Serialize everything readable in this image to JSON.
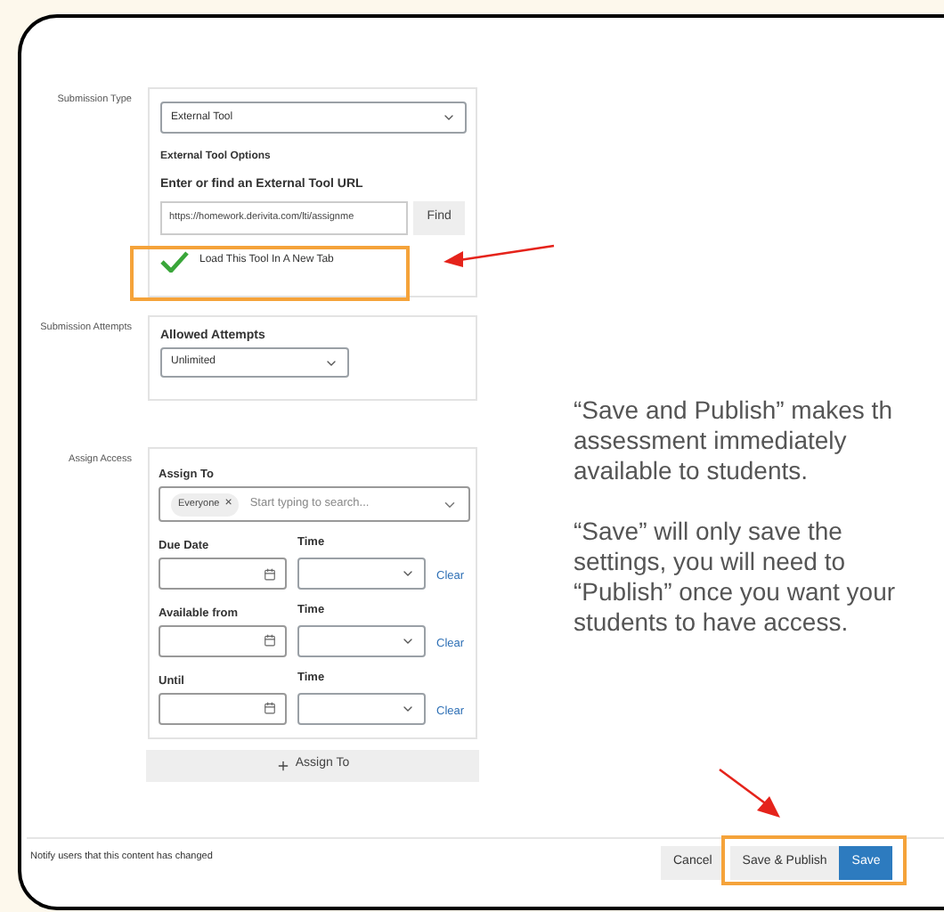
{
  "submission_type": {
    "label": "Submission Type",
    "value": "External Tool",
    "options_heading": "External Tool Options",
    "url_label": "Enter or find an External Tool URL",
    "url_value": "https://homework.derivita.com/lti/assignme",
    "find_button": "Find",
    "new_tab": {
      "label": "Load This Tool In A New Tab",
      "checked": true
    }
  },
  "submission_attempts": {
    "label": "Submission Attempts",
    "heading": "Allowed Attempts",
    "value": "Unlimited"
  },
  "assign_access": {
    "label": "Assign Access",
    "assign_to_label": "Assign To",
    "chips": [
      "Everyone"
    ],
    "chip_remove": "×",
    "placeholder": "Start typing to search...",
    "rows": [
      {
        "label": "Due Date",
        "time_label": "Time",
        "clear": "Clear"
      },
      {
        "label": "Available from",
        "time_label": "Time",
        "clear": "Clear"
      },
      {
        "label": "Until",
        "time_label": "Time",
        "clear": "Clear"
      }
    ],
    "add_button": "Assign To"
  },
  "note": "“Save and Publish” makes th\nassessment immediately\navailable to students.\n\n“Save” will only save the\nsettings, you will need to\n“Publish” once you want your\nstudents to have access.",
  "footer": {
    "notify": "Notify users that this content has changed",
    "buttons": [
      {
        "label": "Cancel",
        "kind": "secondary"
      },
      {
        "label": "Save & Publish",
        "kind": "secondary"
      },
      {
        "label": "Save",
        "kind": "primary"
      }
    ]
  }
}
